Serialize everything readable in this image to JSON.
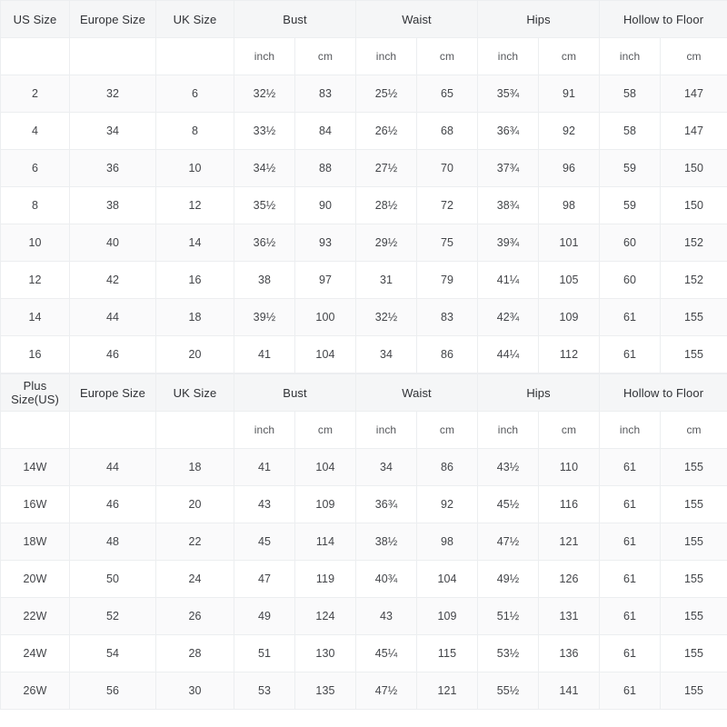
{
  "tables": [
    {
      "id": "standard-size-table",
      "group_headers": [
        {
          "label": "US Size",
          "span": 1
        },
        {
          "label": "Europe Size",
          "span": 1
        },
        {
          "label": "UK Size",
          "span": 1
        },
        {
          "label": "Bust",
          "span": 2
        },
        {
          "label": "Waist",
          "span": 2
        },
        {
          "label": "Hips",
          "span": 2
        },
        {
          "label": "Hollow to Floor",
          "span": 2
        }
      ],
      "unit_row": [
        "",
        "",
        "",
        "inch",
        "cm",
        "inch",
        "cm",
        "inch",
        "cm",
        "inch",
        "cm"
      ],
      "rows": [
        [
          "2",
          "32",
          "6",
          "32½",
          "83",
          "25½",
          "65",
          "35¾",
          "91",
          "58",
          "147"
        ],
        [
          "4",
          "34",
          "8",
          "33½",
          "84",
          "26½",
          "68",
          "36¾",
          "92",
          "58",
          "147"
        ],
        [
          "6",
          "36",
          "10",
          "34½",
          "88",
          "27½",
          "70",
          "37¾",
          "96",
          "59",
          "150"
        ],
        [
          "8",
          "38",
          "12",
          "35½",
          "90",
          "28½",
          "72",
          "38¾",
          "98",
          "59",
          "150"
        ],
        [
          "10",
          "40",
          "14",
          "36½",
          "93",
          "29½",
          "75",
          "39¾",
          "101",
          "60",
          "152"
        ],
        [
          "12",
          "42",
          "16",
          "38",
          "97",
          "31",
          "79",
          "41¼",
          "105",
          "60",
          "152"
        ],
        [
          "14",
          "44",
          "18",
          "39½",
          "100",
          "32½",
          "83",
          "42¾",
          "109",
          "61",
          "155"
        ],
        [
          "16",
          "46",
          "20",
          "41",
          "104",
          "34",
          "86",
          "44¼",
          "112",
          "61",
          "155"
        ]
      ]
    },
    {
      "id": "plus-size-table",
      "group_headers": [
        {
          "label": "Plus Size(US)",
          "span": 1
        },
        {
          "label": "Europe Size",
          "span": 1
        },
        {
          "label": "UK Size",
          "span": 1
        },
        {
          "label": "Bust",
          "span": 2
        },
        {
          "label": "Waist",
          "span": 2
        },
        {
          "label": "Hips",
          "span": 2
        },
        {
          "label": "Hollow to Floor",
          "span": 2
        }
      ],
      "unit_row": [
        "",
        "",
        "",
        "inch",
        "cm",
        "inch",
        "cm",
        "inch",
        "cm",
        "inch",
        "cm"
      ],
      "rows": [
        [
          "14W",
          "44",
          "18",
          "41",
          "104",
          "34",
          "86",
          "43½",
          "110",
          "61",
          "155"
        ],
        [
          "16W",
          "46",
          "20",
          "43",
          "109",
          "36¾",
          "92",
          "45½",
          "116",
          "61",
          "155"
        ],
        [
          "18W",
          "48",
          "22",
          "45",
          "114",
          "38½",
          "98",
          "47½",
          "121",
          "61",
          "155"
        ],
        [
          "20W",
          "50",
          "24",
          "47",
          "119",
          "40¾",
          "104",
          "49½",
          "126",
          "61",
          "155"
        ],
        [
          "22W",
          "52",
          "26",
          "49",
          "124",
          "43",
          "109",
          "51½",
          "131",
          "61",
          "155"
        ],
        [
          "24W",
          "54",
          "28",
          "51",
          "130",
          "45¼",
          "115",
          "53½",
          "136",
          "61",
          "155"
        ],
        [
          "26W",
          "56",
          "30",
          "53",
          "135",
          "47½",
          "121",
          "55½",
          "141",
          "61",
          "155"
        ]
      ]
    }
  ],
  "colors": {
    "header_background": "#f5f6f7",
    "row_stripe": "#fafafb",
    "row_plain": "#ffffff",
    "border": "#eceef0",
    "text": "#434549"
  }
}
